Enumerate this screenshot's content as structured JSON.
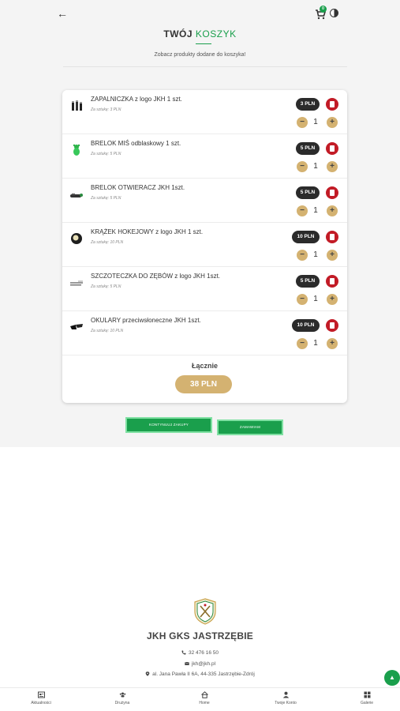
{
  "cart": {
    "badge_count": "0",
    "title_part1": "TWÓJ",
    "title_part2": "KOSZYK",
    "subtitle": "Zobacz produkty dodane do koszyka!"
  },
  "items": [
    {
      "name": "ZAPALNICZKA z logo JKH 1 szt.",
      "note": "Za sztukę: 3 PLN",
      "price": "3 PLN",
      "qty": "1",
      "icon": "lighter-icon"
    },
    {
      "name": "BRELOK MIŚ odblaskowy 1 szt.",
      "note": "Za sztukę: 5 PLN",
      "price": "5 PLN",
      "qty": "1",
      "icon": "bear-keychain-icon"
    },
    {
      "name": "BRELOK OTWIERACZ JKH 1szt.",
      "note": "Za sztukę: 5 PLN",
      "price": "5 PLN",
      "qty": "1",
      "icon": "opener-keychain-icon"
    },
    {
      "name": "KRĄŻEK HOKEJOWY z logo JKH 1 szt.",
      "note": "Za sztukę: 10 PLN",
      "price": "10 PLN",
      "qty": "1",
      "icon": "hockey-puck-icon"
    },
    {
      "name": "SZCZOTECZKA DO ZĘBÓW z logo JKH 1szt.",
      "note": "Za sztukę: 5 PLN",
      "price": "5 PLN",
      "qty": "1",
      "icon": "toothbrush-icon"
    },
    {
      "name": "OKULARY przeciwsłoneczne JKH 1szt.",
      "note": "Za sztukę: 10 PLN",
      "price": "10 PLN",
      "qty": "1",
      "icon": "sunglasses-icon"
    }
  ],
  "summary": {
    "total_label": "Łącznie",
    "total_value": "38 PLN"
  },
  "buttons": {
    "continue_label": "KONTYNUUJ ZAKUPY",
    "order_label": "ZAMAWIAM"
  },
  "footer": {
    "club_name": "JKH GKS JASTRZĘBIE",
    "phone": "32 476 16 50",
    "email": "jkh@jkh.pl",
    "address": "al. Jana Pawła II 6A, 44-335 Jastrzębie-Zdrój"
  },
  "nav": [
    {
      "label": "Aktualności",
      "icon": "news-icon"
    },
    {
      "label": "Drużyna",
      "icon": "team-icon"
    },
    {
      "label": "Home",
      "icon": "home-icon"
    },
    {
      "label": "Twoje Konto",
      "icon": "account-icon"
    },
    {
      "label": "Galerie",
      "icon": "gallery-icon"
    }
  ],
  "colors": {
    "brand_green": "#1a9f4c",
    "gold": "#d4b271",
    "delete_red": "#c21b26",
    "price_dark": "#2b2b2b"
  }
}
